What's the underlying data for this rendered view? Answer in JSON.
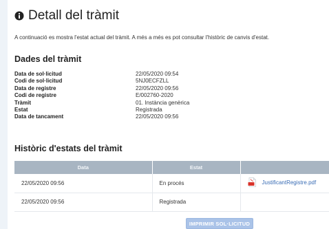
{
  "header": {
    "title": "Detall del tràmit",
    "icon": "info-circle-icon",
    "intro": "A continuació es mostra l'estat actual del tràmit. A més a més es pot consultar l'històric de canvis d'estat."
  },
  "dades": {
    "heading": "Dades del tràmit",
    "rows": [
      {
        "label": "Data de sol·licitud",
        "value": "22/05/2020 09:54"
      },
      {
        "label": "Codi de sol·licitud",
        "value": "5NJ0ECFZLL"
      },
      {
        "label": "Data de registre",
        "value": "22/05/2020 09:56"
      },
      {
        "label": "Codi de registre",
        "value": "E/002760-2020"
      },
      {
        "label": "Tràmit",
        "value": "01. Instància genèrica"
      },
      {
        "label": "Estat",
        "value": "Registrada"
      },
      {
        "label": "Data de tancament",
        "value": "22/05/2020 09:56"
      }
    ]
  },
  "historic": {
    "heading": "Històric d'estats del tràmit",
    "columns": [
      "Data",
      "Estat",
      ""
    ],
    "rows": [
      {
        "date": "22/05/2020 09:56",
        "state": "En procés",
        "document": "JustificantRegistre.pdf",
        "document_icon": "pdf-icon"
      },
      {
        "date": "22/05/2020 09:56",
        "state": "Registrada",
        "document": ""
      }
    ]
  },
  "actions": {
    "print_label": "IMPRIMIR SOL·LICITUD"
  },
  "colors": {
    "page_bg": "#eef3f8",
    "table_header_bg": "#a8b5c2",
    "link": "#3a6db5",
    "button_bg": "#aac3e8",
    "pdf_red": "#d9332b"
  }
}
